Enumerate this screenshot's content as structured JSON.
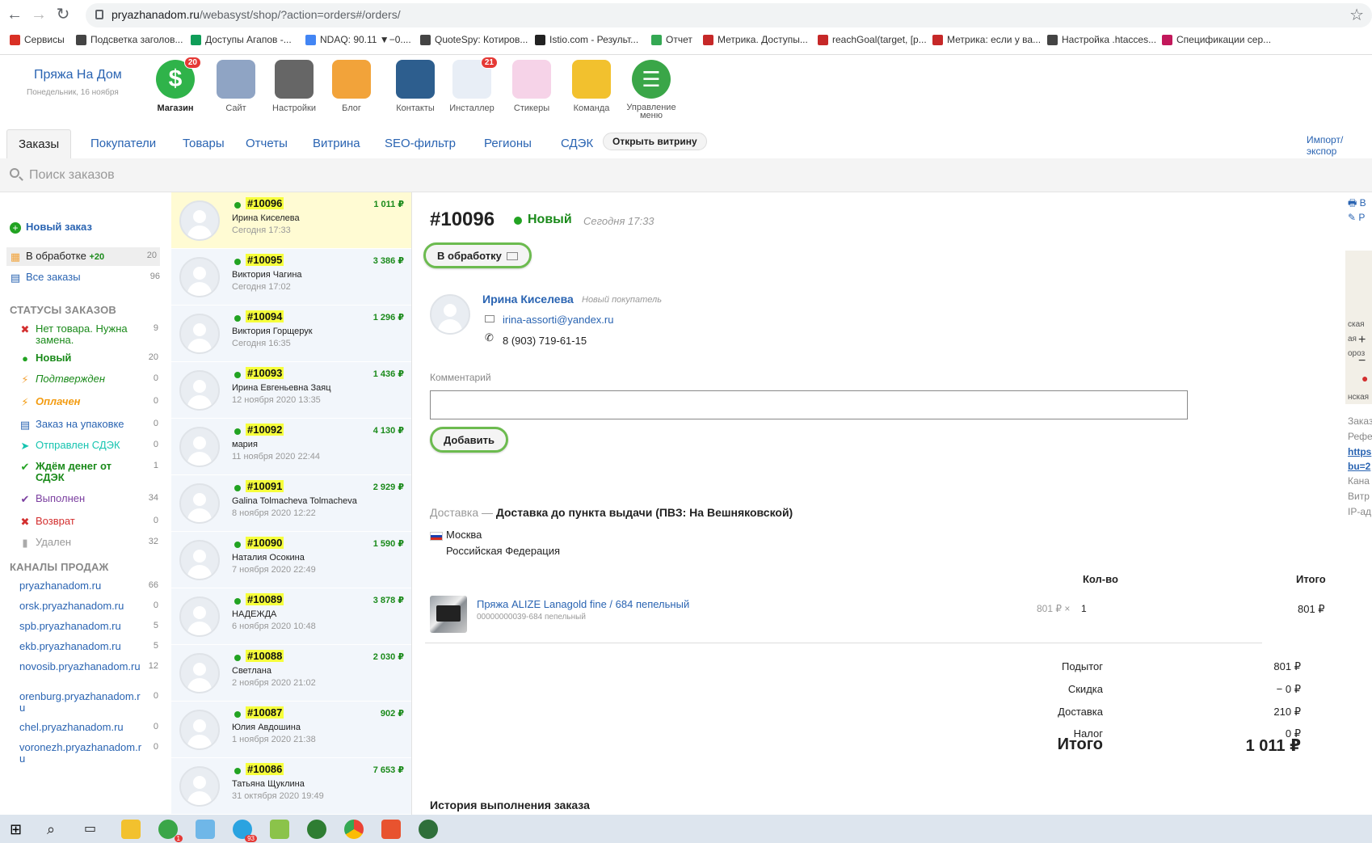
{
  "browser": {
    "url_host": "pryazhanadom.ru",
    "url_path": "/webasyst/shop/?action=orders#/orders/",
    "bookmarks": [
      {
        "label": "Сервисы",
        "color": "#d93025"
      },
      {
        "label": "Подсветка заголов...",
        "color": "#444"
      },
      {
        "label": "Доступы Агапов -...",
        "color": "#0f9d58"
      },
      {
        "label": "NDAQ: 90.11 ▼−0....",
        "color": "#4285f4"
      },
      {
        "label": "QuoteSpy: Котиров...",
        "color": "#444"
      },
      {
        "label": "Istio.com - Результ...",
        "color": "#222"
      },
      {
        "label": "Отчет",
        "color": "#34a853"
      },
      {
        "label": "Метрика. Доступы...",
        "color": "#c62828"
      },
      {
        "label": "reachGoal(target, [p...",
        "color": "#c62828"
      },
      {
        "label": "Метрика: если у ва...",
        "color": "#c62828"
      },
      {
        "label": "Настройка .htacces...",
        "color": "#444"
      },
      {
        "label": "Спецификации сер...",
        "color": "#c2185b"
      }
    ]
  },
  "header": {
    "brand": "Пряжа На Дом",
    "date": "Понедельник, 16 ноября",
    "apps": [
      {
        "label": "Магазин",
        "badge": "20",
        "color": "#2fb34a",
        "icon": "dollar-icon"
      },
      {
        "label": "Сайт",
        "badge": "",
        "color": "#8fa4c4",
        "icon": "site-icon"
      },
      {
        "label": "Настройки",
        "badge": "",
        "color": "#666",
        "icon": "gear-icon"
      },
      {
        "label": "Блог",
        "badge": "",
        "color": "#f2a33a",
        "icon": "pencil-icon"
      },
      {
        "label": "Контакты",
        "badge": "",
        "color": "#2d5e8e",
        "icon": "contacts-icon"
      },
      {
        "label": "Инсталлер",
        "badge": "21",
        "color": "#e8eef6",
        "icon": "installer-icon"
      },
      {
        "label": "Стикеры",
        "badge": "",
        "color": "#f6d3e8",
        "icon": "stickers-icon"
      },
      {
        "label": "Команда",
        "badge": "",
        "color": "#f2c12e",
        "icon": "team-icon"
      },
      {
        "label": "Управление меню",
        "badge": "",
        "color": "#3aa648",
        "icon": "menu-icon"
      }
    ]
  },
  "tabs": [
    {
      "label": "Заказы"
    },
    {
      "label": "Покупатели"
    },
    {
      "label": "Товары"
    },
    {
      "label": "Отчеты"
    },
    {
      "label": "Витрина"
    },
    {
      "label": "SEO-фильтр"
    },
    {
      "label": "Регионы"
    },
    {
      "label": "СДЭК"
    }
  ],
  "open_store": "Открыть витрину",
  "import_export": "Импорт/экспор",
  "search": {
    "placeholder": "Поиск заказов"
  },
  "sidebar": {
    "new_order": "Новый заказ",
    "in_process": {
      "label": "В обработке",
      "plus": "+20",
      "count": "20"
    },
    "all_orders": {
      "label": "Все заказы",
      "count": "96"
    },
    "statuses_heading": "СТАТУСЫ ЗАКАЗОВ",
    "statuses": [
      {
        "label": "Нет товара. Нужна замена.",
        "count": "9",
        "color": "#1a8a1a",
        "icon": "✖",
        "icon_color": "#d32f2f",
        "style": "normal"
      },
      {
        "label": "Новый",
        "count": "20",
        "color": "#1a8a1a",
        "icon": "●",
        "icon_color": "#22a322",
        "style": "bold"
      },
      {
        "label": "Подтвержден",
        "count": "0",
        "color": "#1a8a1a",
        "icon": "⚡",
        "icon_color": "#f2a33a",
        "style": "italic"
      },
      {
        "label": "Оплачен",
        "count": "0",
        "color": "#f39c12",
        "icon": "⚡",
        "icon_color": "#f39c12",
        "style": "italic-bold"
      },
      {
        "label": "Заказ на упаковке",
        "count": "0",
        "color": "#2a64b2",
        "icon": "▤",
        "icon_color": "#2a64b2",
        "style": "normal"
      },
      {
        "label": "Отправлен СДЭК",
        "count": "0",
        "color": "#16c4b0",
        "icon": "➤",
        "icon_color": "#16c4b0",
        "style": "normal"
      },
      {
        "label": "Ждём денег от СДЭК",
        "count": "1",
        "color": "#1a8a1a",
        "icon": "✔",
        "icon_color": "#22a322",
        "style": "bold"
      },
      {
        "label": "Выполнен",
        "count": "34",
        "color": "#7b3fa0",
        "icon": "✔",
        "icon_color": "#7b3fa0",
        "style": "normal"
      },
      {
        "label": "Возврат",
        "count": "0",
        "color": "#d32f2f",
        "icon": "✖",
        "icon_color": "#d32f2f",
        "style": "normal"
      },
      {
        "label": "Удален",
        "count": "32",
        "color": "#999",
        "icon": "▮",
        "icon_color": "#aaa",
        "style": "normal"
      }
    ],
    "channels_heading": "КАНАЛЫ ПРОДАЖ",
    "channels": [
      {
        "label": "pryazhanadom.ru",
        "count": "66"
      },
      {
        "label": "orsk.pryazhanadom.ru",
        "count": "0"
      },
      {
        "label": "spb.pryazhanadom.ru",
        "count": "5"
      },
      {
        "label": "ekb.pryazhanadom.ru",
        "count": "5"
      },
      {
        "label": "novosib.pryazhanadom.ru",
        "count": "12"
      },
      {
        "label": "orenburg.pryazhanadom.ru",
        "count": "0"
      },
      {
        "label": "chel.pryazhanadom.ru",
        "count": "0"
      },
      {
        "label": "voronezh.pryazhanadom.ru",
        "count": "0"
      }
    ]
  },
  "orders": [
    {
      "num": "#10096",
      "sum": "1 011 ₽",
      "name": "Ирина Киселева",
      "date": "Сегодня 17:33"
    },
    {
      "num": "#10095",
      "sum": "3 386 ₽",
      "name": "Виктория Чагина",
      "date": "Сегодня 17:02"
    },
    {
      "num": "#10094",
      "sum": "1 296 ₽",
      "name": "Виктория Горщерук",
      "date": "Сегодня 16:35"
    },
    {
      "num": "#10093",
      "sum": "1 436 ₽",
      "name": "Ирина Евгеньевна Заяц",
      "date": "12 ноября 2020 13:35"
    },
    {
      "num": "#10092",
      "sum": "4 130 ₽",
      "name": "мария",
      "date": "11 ноября 2020 22:44"
    },
    {
      "num": "#10091",
      "sum": "2 929 ₽",
      "name": "Galina Tolmacheva Tolmacheva",
      "date": "8 ноября 2020 12:22"
    },
    {
      "num": "#10090",
      "sum": "1 590 ₽",
      "name": "Наталия Осокина",
      "date": "7 ноября 2020 22:49"
    },
    {
      "num": "#10089",
      "sum": "3 878 ₽",
      "name": "НАДЕЖДА",
      "date": "6 ноября 2020 10:48"
    },
    {
      "num": "#10088",
      "sum": "2 030 ₽",
      "name": "Светлана",
      "date": "2 ноября 2020 21:02"
    },
    {
      "num": "#10087",
      "sum": "902 ₽",
      "name": "Юлия Авдошина",
      "date": "1 ноября 2020 21:38"
    },
    {
      "num": "#10086",
      "sum": "7 653 ₽",
      "name": "Татьяна Щуклина",
      "date": "31 октября 2020 19:49"
    }
  ],
  "order": {
    "number": "#10096",
    "status": "Новый",
    "time": "Сегодня 17:33",
    "process_button": "В обработку",
    "customer": {
      "name": "Ирина Киселева",
      "type": "Новый покупатель",
      "email": "irina-assorti@yandex.ru",
      "phone": "8 (903) 719-61-15"
    },
    "comment_label": "Комментарий",
    "add_button": "Добавить",
    "delivery_label": "Доставка —",
    "delivery_value": "Доставка до пункта выдачи (ПВЗ: На Вешняковской)",
    "city": "Москва",
    "country": "Российская Федерация",
    "col_qty": "Кол-во",
    "col_total": "Итого",
    "item": {
      "name": "Пряжа ALIZE Lanagold fine / 684 пепельный",
      "sku": "00000000039-684 пепельный",
      "price": "801 ₽ ×",
      "qty": "1",
      "total": "801 ₽"
    },
    "totals": [
      {
        "label": "Подытог",
        "value": "801 ₽"
      },
      {
        "label": "Скидка",
        "value": "− 0 ₽"
      },
      {
        "label": "Доставка",
        "value": "210 ₽"
      },
      {
        "label": "Налог",
        "value": "0 ₽"
      }
    ],
    "grand_label": "Итого",
    "grand_value": "1 011 ₽",
    "history_heading": "История выполнения заказа"
  },
  "right_panel": {
    "top_links": [
      "В",
      "Р"
    ],
    "map_labels": [
      "ская",
      "ая",
      "ороз",
      "нская"
    ],
    "info": [
      "Заказ",
      "Рефе",
      "https",
      "bu=2",
      "Кана",
      "Витр",
      "IP-ад"
    ]
  }
}
